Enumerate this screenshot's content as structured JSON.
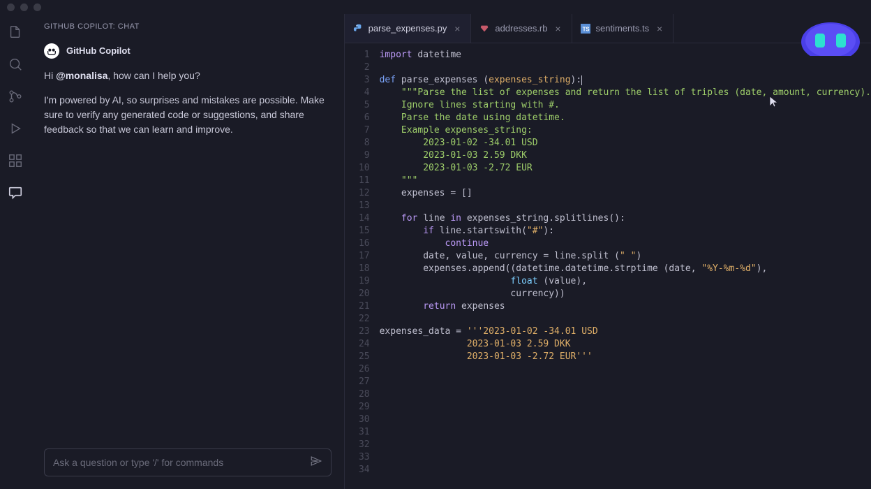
{
  "chat": {
    "header": "GITHUB COPILOT: CHAT",
    "name": "GitHub Copilot",
    "greeting_pre": "Hi ",
    "greeting_mention": "@monalisa",
    "greeting_post": ", how can I help you?",
    "disclaimer": "I'm powered by AI, so surprises and mistakes are possible. Make sure to verify any generated code or suggestions, and share feedback so that we can learn and improve.",
    "input_placeholder": "Ask a question or type '/' for commands"
  },
  "tabs": [
    {
      "label": "parse_expenses.py",
      "icon": "python",
      "active": true
    },
    {
      "label": "addresses.rb",
      "icon": "ruby",
      "active": false
    },
    {
      "label": "sentiments.ts",
      "icon": "typescript",
      "active": false
    }
  ],
  "code": {
    "lines": [
      {
        "n": 1,
        "seg": [
          {
            "t": "import",
            "c": "key"
          },
          {
            "t": " datetime",
            "c": ""
          }
        ]
      },
      {
        "n": 2,
        "seg": []
      },
      {
        "n": 3,
        "seg": [
          {
            "t": "def",
            "c": "def"
          },
          {
            "t": " parse_expenses ",
            "c": "fn"
          },
          {
            "t": "(",
            "c": ""
          },
          {
            "t": "expenses_string",
            "c": "arg"
          },
          {
            "t": "):",
            "c": ""
          }
        ],
        "cursor": true
      },
      {
        "n": 4,
        "seg": [
          {
            "t": "    ",
            "c": ""
          },
          {
            "t": "\"\"\"Parse the list of expenses and return the list of triples (date, amount, currency).",
            "c": "str"
          }
        ]
      },
      {
        "n": 5,
        "seg": [
          {
            "t": "    Ignore lines starting with #.",
            "c": "str"
          }
        ]
      },
      {
        "n": 6,
        "seg": [
          {
            "t": "    Parse the date using datetime.",
            "c": "str"
          }
        ]
      },
      {
        "n": 7,
        "seg": [
          {
            "t": "    Example expenses_string:",
            "c": "str"
          }
        ]
      },
      {
        "n": 8,
        "seg": [
          {
            "t": "        2023-01-02 -34.01 USD",
            "c": "str"
          }
        ]
      },
      {
        "n": 9,
        "seg": [
          {
            "t": "        2023-01-03 2.59 DKK",
            "c": "str"
          }
        ]
      },
      {
        "n": 10,
        "seg": [
          {
            "t": "        2023-01-03 -2.72 EUR",
            "c": "str"
          }
        ]
      },
      {
        "n": 11,
        "seg": [
          {
            "t": "    \"\"\"",
            "c": "str"
          }
        ]
      },
      {
        "n": 12,
        "seg": [
          {
            "t": "    expenses = []",
            "c": ""
          }
        ]
      },
      {
        "n": 13,
        "seg": []
      },
      {
        "n": 14,
        "seg": [
          {
            "t": "    ",
            "c": ""
          },
          {
            "t": "for",
            "c": "key"
          },
          {
            "t": " line ",
            "c": ""
          },
          {
            "t": "in",
            "c": "key"
          },
          {
            "t": " expenses_string.splitlines():",
            "c": ""
          }
        ]
      },
      {
        "n": 15,
        "seg": [
          {
            "t": "        ",
            "c": ""
          },
          {
            "t": "if",
            "c": "key"
          },
          {
            "t": " line.startswith(",
            "c": ""
          },
          {
            "t": "\"#\"",
            "c": "strlit"
          },
          {
            "t": "):",
            "c": ""
          }
        ]
      },
      {
        "n": 16,
        "seg": [
          {
            "t": "            ",
            "c": ""
          },
          {
            "t": "continue",
            "c": "key"
          }
        ]
      },
      {
        "n": 17,
        "seg": [
          {
            "t": "        date, value, currency = line.split (",
            "c": ""
          },
          {
            "t": "\" \"",
            "c": "strlit"
          },
          {
            "t": ")",
            "c": ""
          }
        ]
      },
      {
        "n": 18,
        "seg": [
          {
            "t": "        expenses.append((datetime.datetime.strptime (date, ",
            "c": ""
          },
          {
            "t": "\"%Y-%m-%d\"",
            "c": "strlit"
          },
          {
            "t": "),",
            "c": ""
          }
        ]
      },
      {
        "n": 19,
        "seg": [
          {
            "t": "                        ",
            "c": ""
          },
          {
            "t": "float",
            "c": "builtin"
          },
          {
            "t": " (value),",
            "c": ""
          }
        ]
      },
      {
        "n": 20,
        "seg": [
          {
            "t": "                        currency))",
            "c": ""
          }
        ]
      },
      {
        "n": 21,
        "seg": [
          {
            "t": "        ",
            "c": ""
          },
          {
            "t": "return",
            "c": "key"
          },
          {
            "t": " expenses",
            "c": ""
          }
        ]
      },
      {
        "n": 22,
        "seg": []
      },
      {
        "n": 23,
        "seg": [
          {
            "t": "expenses_data = ",
            "c": ""
          },
          {
            "t": "'''2023-01-02 -34.01 USD",
            "c": "strlit"
          }
        ]
      },
      {
        "n": 24,
        "seg": [
          {
            "t": "                2023-01-03 2.59 DKK",
            "c": "strlit"
          }
        ]
      },
      {
        "n": 25,
        "seg": [
          {
            "t": "                2023-01-03 -2.72 EUR'''",
            "c": "strlit"
          }
        ]
      },
      {
        "n": 26,
        "seg": []
      },
      {
        "n": 27,
        "seg": []
      },
      {
        "n": 28,
        "seg": []
      },
      {
        "n": 29,
        "seg": []
      },
      {
        "n": 30,
        "seg": []
      },
      {
        "n": 31,
        "seg": []
      },
      {
        "n": 32,
        "seg": []
      },
      {
        "n": 33,
        "seg": []
      },
      {
        "n": 34,
        "seg": []
      }
    ]
  }
}
